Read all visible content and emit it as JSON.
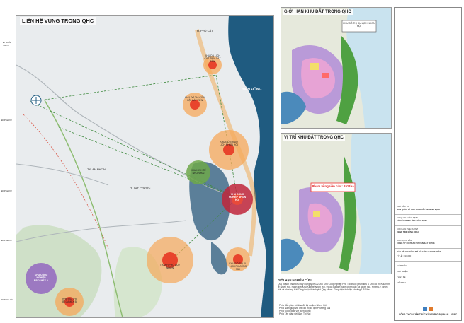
{
  "main_map": {
    "title": "LIÊN HỆ VÙNG TRONG QHC",
    "sea_label": "BIỂN ĐÔNG",
    "district_labels": [
      "H. PHÙ CÁT",
      "H. TUY PHƯỚC",
      "TX. AN NHƠN"
    ],
    "zones": [
      {
        "id": "cat-tien",
        "label": "KHU DU LỊCH CÁT TIẾN CÁT TÂN"
      },
      {
        "id": "cua-hoi",
        "label": "KHU ĐÔ THỊ CỬA HỘI CÁT TIẾN"
      },
      {
        "id": "nhon-ly",
        "label": "KHU ĐÔ THỊ DU LỊCH NHƠN HỘI"
      },
      {
        "id": "nhon-hai",
        "label": "KHU KINH TẾ NHƠN HẢI"
      },
      {
        "id": "qhc",
        "label": "KHU CÔNG NGHIỆP NHƠN HỘI"
      },
      {
        "id": "quy-nhon",
        "label": "THÀNH PHỐ QUY NHƠN"
      },
      {
        "id": "phuong-mai",
        "label": "KHU ĐÔ THỊ DU LỊCH PHƯƠNG MAI"
      },
      {
        "id": "cong-nghiep",
        "label": "KHU CÔNG NGHIỆP BECAMEX A"
      },
      {
        "id": "do-thi-becamex",
        "label": "KHU ĐÔ THỊ BECAMEX B"
      }
    ],
    "side_labels": [
      "ĐI HOÀI NHƠN",
      "ĐI PLEIKU",
      "ĐI PLEIKU",
      "ĐI PLEIKU",
      "ĐI TUY HÒA"
    ]
  },
  "inset_top": {
    "title": "GIỚI HẠN KHU ĐẤT TRONG QHC",
    "callout": "KHU ĐÔ THỊ DU LỊCH NHƠN HỘI"
  },
  "inset_bottom": {
    "title": "VỊ TRÍ KHU ĐẤT TRONG QHC",
    "highlight": "Phạm vi nghiên cứu: 1511ha"
  },
  "notes": {
    "title": "GIỚI HẠN NGHIÊN CỨU",
    "body": "Quy hoạch phân khu xây dựng tỷ lệ 1/2.000 Khu Công nghiệp Phú Tài thuộc phân khu 4 Khu đô thị Khu Kinh tế Nhơn Hội. Ranh giới Khu Kinh tế Nhơn Hội, thuộc địa giới hành chính các xã Nhơn Hội, Nhơn Lý, Nhơn Hải và phường Hải Cảng thuộc thành phố Quy Nhơn. Tổng diện tích lập khoảng 1.511ha.",
    "list": [
      "- Phía Bắc giáp với khu đô thị du lịch Nhơn Hội",
      "- Phía Nam giáp với khu đô thị du lịch Phương Mai",
      "- Phía Đông giáp với Biển Đông",
      "- Phía Tây giáp với đầm Thị Nại"
    ]
  },
  "title_block": {
    "rows": [
      "CHỦ ĐẦU TƯ",
      "BAN QUẢN LÝ KHU KINH TẾ TỈNH BÌNH ĐỊNH",
      "CƠ QUAN THẨM ĐỊNH",
      "SỞ XÂY DỰNG TỈNH BÌNH ĐỊNH",
      "CƠ QUAN PHÊ DUYỆT",
      "UBND TỈNH BÌNH ĐỊNH",
      "ĐƠN VỊ TƯ VẤN",
      "CÔNG TY CỔ PHẦN TƯ VẤN XÂY DỰNG",
      "BẢN VẼ: SƠ ĐỒ VỊ TRÍ VÀ GIỚI HẠN KHU ĐẤT",
      "TỶ LỆ: 1/10.000",
      "GIÁM ĐỐC",
      "CHỦ NHIỆM",
      "THIẾT KẾ",
      "KIỂM TRA"
    ],
    "company": "CÔNG TY CP KIẾN TRÚC XÂY DỰNG ĐẠI NAM - VNAC"
  }
}
